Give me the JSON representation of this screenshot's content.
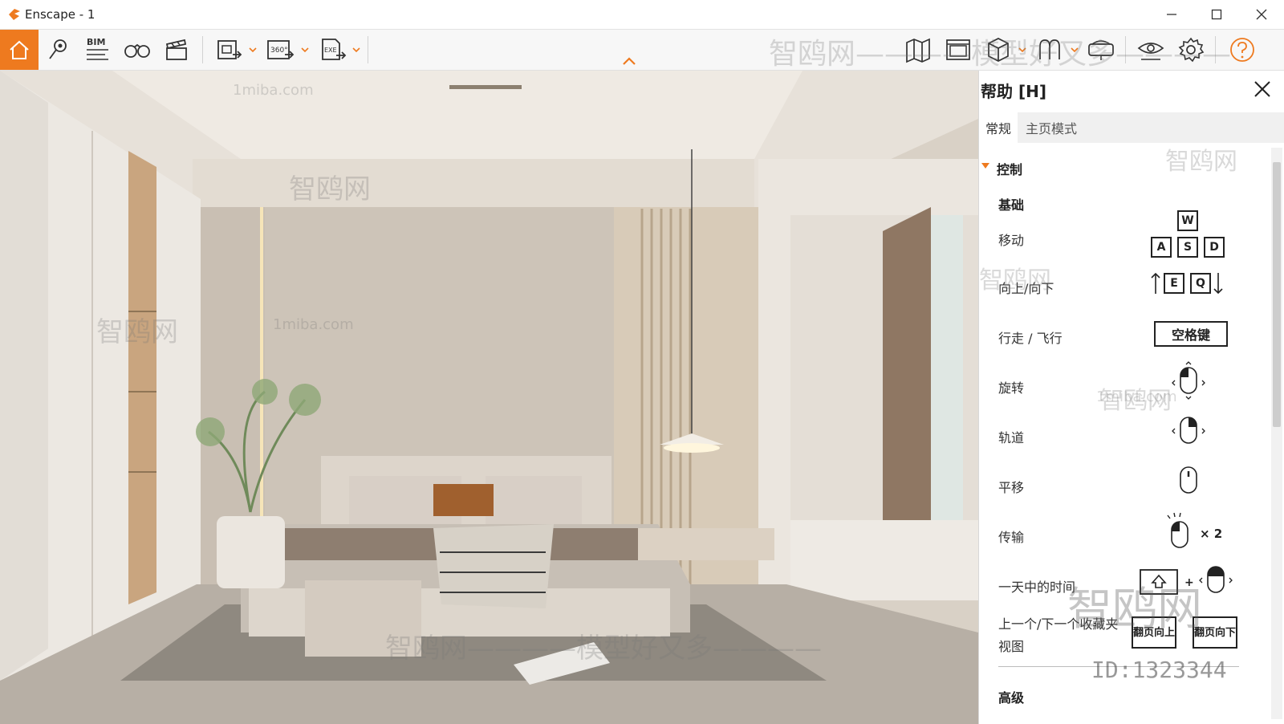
{
  "window": {
    "title": "Enscape - 1",
    "controls": {
      "minimize": "—",
      "maximize": "☐",
      "close": "✕"
    }
  },
  "toolbar": {
    "bim_label": "BIM",
    "pano_label": "360°",
    "exe_label": "EXE",
    "accent_color": "#ee7a1f",
    "left_icons": [
      "home-icon",
      "location-pin-icon",
      "bim-icon",
      "binoculars-icon",
      "clapperboard-icon",
      "screenshot-export-icon",
      "panorama-360-icon",
      "exe-export-icon"
    ],
    "right_icons": [
      "map-icon",
      "view-management-icon",
      "asset-library-icon",
      "material-editor-icon",
      "vr-headset-icon",
      "eye-icon",
      "settings-gear-icon",
      "help-icon"
    ]
  },
  "help_panel": {
    "title": "帮助 [H]",
    "tabs": [
      {
        "label": "常规",
        "active": true
      },
      {
        "label": "主页模式",
        "active": false
      }
    ],
    "section": "控制",
    "basics_heading": "基础",
    "rows": {
      "move": "移动",
      "up_down": "向上/向下",
      "walk_fly": "行走 / 飞行",
      "rotate": "旋转",
      "orbit": "轨道",
      "pan": "平移",
      "teleport": "传输",
      "time_of_day": "一天中的时间",
      "prev_next_view": "上一个/下一个收藏夹视图"
    },
    "keys": {
      "w": "W",
      "a": "A",
      "s": "S",
      "d": "D",
      "e": "E",
      "q": "Q"
    },
    "space_key": "空格键",
    "double_click": "× 2",
    "page_up": "翻页向上",
    "page_down": "翻页向下",
    "advanced_heading": "高级"
  },
  "watermarks": {
    "brand_cn": "智鸥网",
    "slogan": "智鸥网————模型好又多————",
    "site": "1miba.com",
    "id_text": "ID:1323344"
  }
}
